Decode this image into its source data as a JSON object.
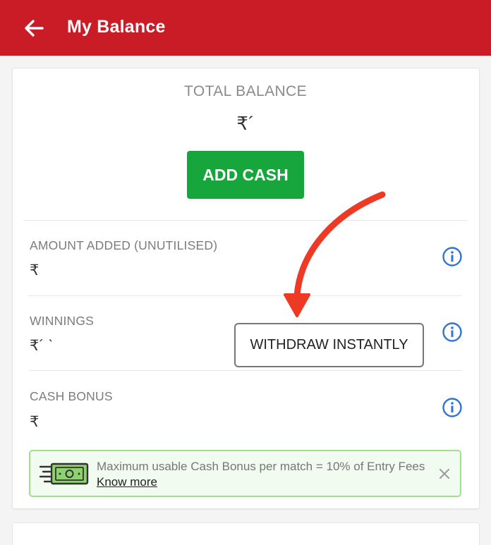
{
  "header": {
    "title": "My Balance",
    "background_color": "#c91c27",
    "back_icon": "arrow-left-icon"
  },
  "balance": {
    "total_label": "TOTAL BALANCE",
    "total_value": "₹´",
    "add_cash_label": "ADD CASH",
    "add_cash_color": "#16a63c"
  },
  "rows": {
    "amount_added": {
      "label": "AMOUNT ADDED (UNUTILISED)",
      "value": "₹",
      "icon": "info-icon"
    },
    "winnings": {
      "label": "WINNINGS",
      "value": "₹´ ˋ",
      "withdraw_label": "WITHDRAW INSTANTLY",
      "icon": "info-icon"
    },
    "cash_bonus": {
      "label": "CASH BONUS",
      "value": "₹",
      "icon": "info-icon"
    }
  },
  "bonus_banner": {
    "text": "Maximum usable Cash Bonus per match = 10% of Entry Fees",
    "link_label": "Know more",
    "icon": "cash-note-icon",
    "close_icon": "close-icon"
  },
  "annotation": {
    "arrow_icon": "red-curved-arrow-icon",
    "color": "#ee3a24"
  }
}
